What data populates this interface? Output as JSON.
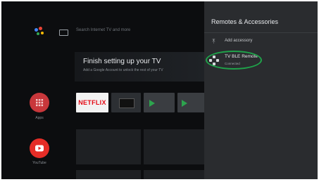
{
  "search": {
    "placeholder": "Search Internet TV and more"
  },
  "setup_card": {
    "title": "Finish setting up your TV",
    "subtitle": "Add a Google Account to unlock the rest of your TV"
  },
  "apps": [
    {
      "label": "Apps",
      "color": "#c8373b"
    },
    {
      "label": "YouTube",
      "color": "#e52d27"
    }
  ],
  "tiles": {
    "netflix_label": "NETFLIX"
  },
  "panel": {
    "title": "Remotes & Accessories",
    "add_accessory_label": "Add accessory",
    "remote": {
      "name": "TV BLE Remote",
      "status": "Connected"
    }
  },
  "colors": {
    "highlight": "#1fa34a",
    "netflix_red": "#e50914",
    "panel_bg": "#2a2c2f",
    "background": "#0c0d0f"
  },
  "icons": [
    "google-assistant-icon",
    "keyboard-icon",
    "apps-grid-icon",
    "youtube-play-icon",
    "bluetooth-icon",
    "remote-dpad-icon",
    "google-play-icon"
  ]
}
